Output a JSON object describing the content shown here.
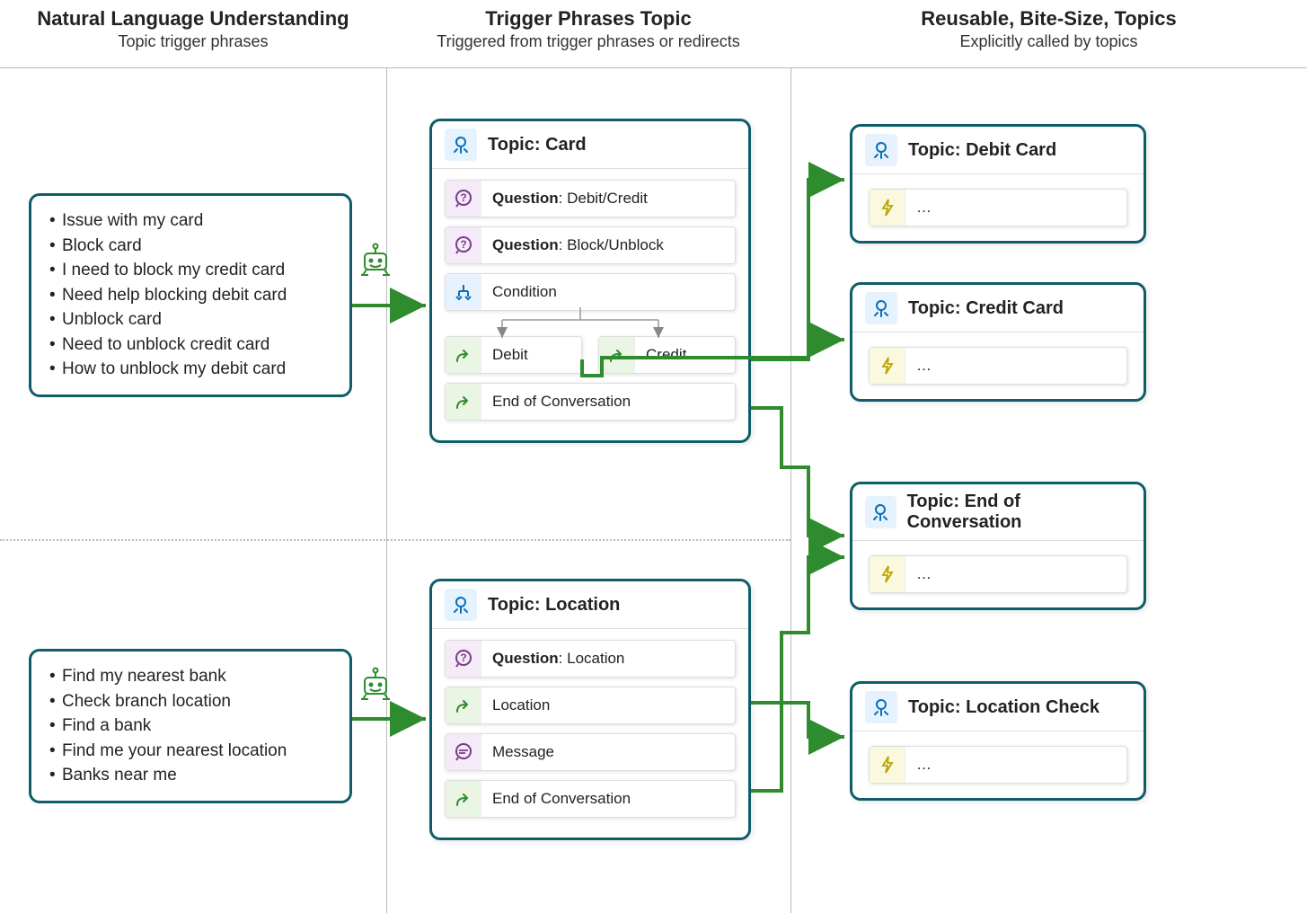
{
  "columns": {
    "col1": {
      "title": "Natural Language Understanding",
      "subtitle": "Topic trigger phrases"
    },
    "col2": {
      "title": "Trigger Phrases Topic",
      "subtitle": "Triggered from trigger phrases or redirects"
    },
    "col3": {
      "title": "Reusable, Bite-Size, Topics",
      "subtitle": "Explicitly called by topics"
    }
  },
  "phrases_card": {
    "items": [
      "Issue with my card",
      "Block card",
      "I need to block my credit card",
      "Need help blocking debit card",
      "Unblock card",
      "Need to unblock credit card",
      "How to unblock my debit card"
    ]
  },
  "phrases_location": {
    "items": [
      "Find my nearest bank",
      "Check branch location",
      "Find a bank",
      "Find me your nearest location",
      "Banks near me"
    ]
  },
  "topic_card": {
    "title": "Topic: Card",
    "q1_label": "Question",
    "q1_value": ": Debit/Credit",
    "q2_label": "Question",
    "q2_value": ": Block/Unblock",
    "condition": "Condition",
    "branch_debit": "Debit",
    "branch_credit": "Credit",
    "eoc": "End of Conversation"
  },
  "topic_location": {
    "title": "Topic: Location",
    "q_label": "Question",
    "q_value": ": Location",
    "loc": "Location",
    "msg": "Message",
    "eoc": "End of Conversation"
  },
  "mini": {
    "debit": {
      "title": "Topic: Debit Card",
      "body": "…"
    },
    "credit": {
      "title": "Topic: Credit Card",
      "body": "…"
    },
    "eoc": {
      "title": "Topic: End of Conversation",
      "body": "…"
    },
    "loc": {
      "title": "Topic: Location Check",
      "body": "…"
    }
  }
}
